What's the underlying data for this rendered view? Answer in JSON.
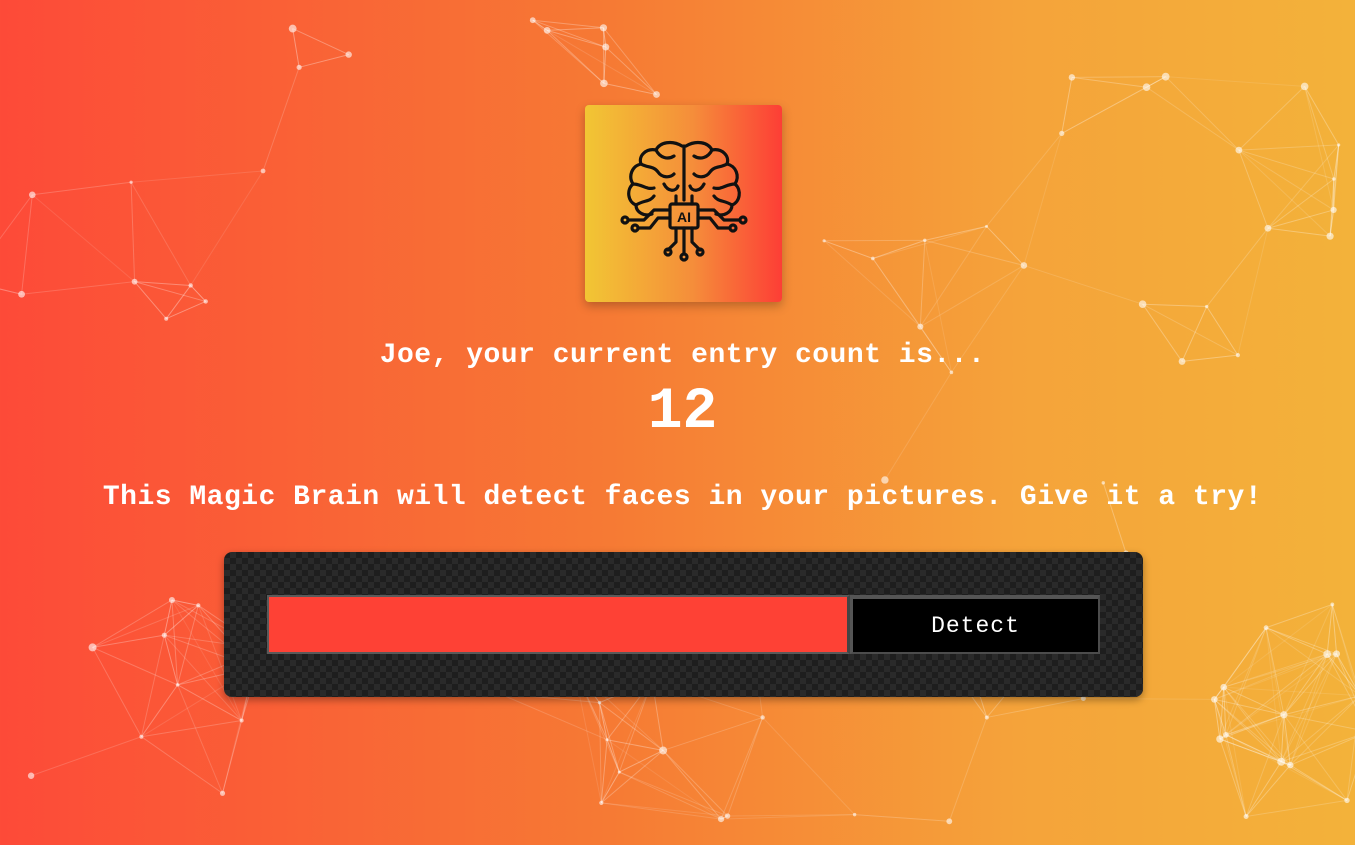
{
  "logo": {
    "icon": "ai-brain-icon",
    "label": "AI"
  },
  "rank": {
    "message": "Joe, your current entry count is...",
    "count": "12"
  },
  "tagline": "This Magic Brain will detect faces in your pictures. Give it a try!",
  "image_form": {
    "input_value": "",
    "input_placeholder": "",
    "detect_label": "Detect"
  },
  "colors": {
    "gradient_start": "#fd4a38",
    "gradient_end": "#f3b23a",
    "input_background": "#fe4135",
    "button_background": "#000000",
    "panel_background": "#1e1e1e",
    "text": "#ffffff"
  }
}
